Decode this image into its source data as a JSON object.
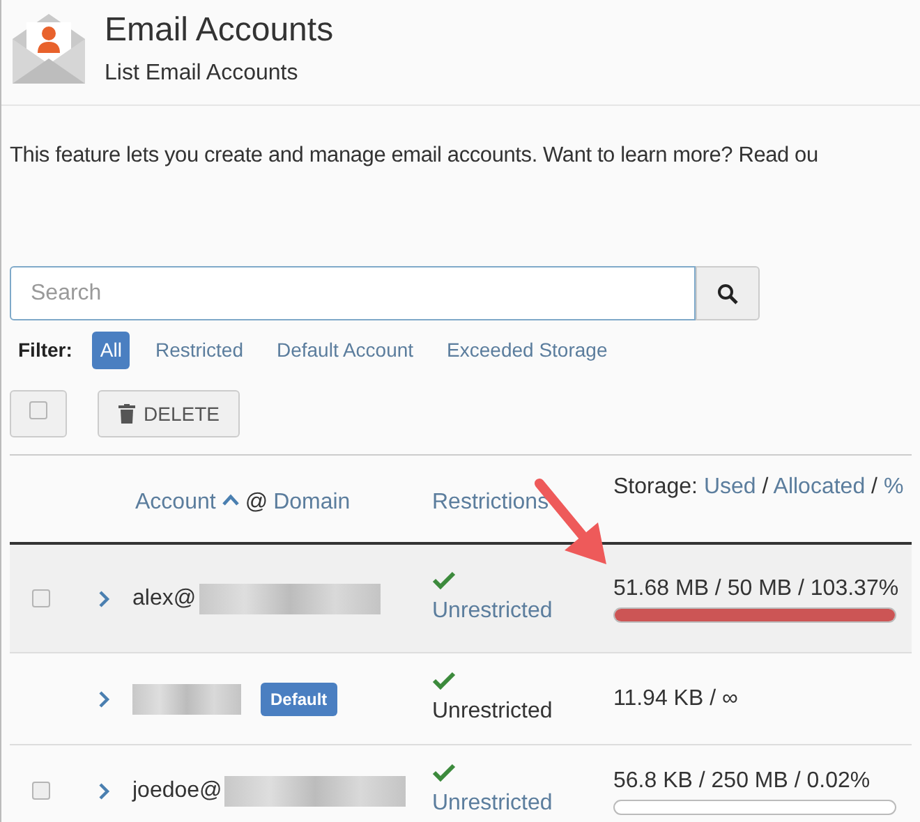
{
  "header": {
    "title": "Email Accounts",
    "subtitle": "List Email Accounts"
  },
  "description": "This feature lets you create and manage email accounts. Want to learn more? Read ou",
  "search": {
    "placeholder": "Search"
  },
  "filter": {
    "label": "Filter:",
    "options": [
      {
        "label": "All",
        "selected": true
      },
      {
        "label": "Restricted",
        "selected": false
      },
      {
        "label": "Default Account",
        "selected": false
      },
      {
        "label": "Exceeded Storage",
        "selected": false
      }
    ]
  },
  "toolbar": {
    "select_all_checked": false,
    "delete_label": "DELETE"
  },
  "table": {
    "columns": {
      "account": "Account",
      "at": "@",
      "domain": "Domain",
      "restrictions": "Restrictions",
      "storage": "Storage:",
      "used": "Used",
      "separator_1": "/",
      "allocated": "Allocated",
      "separator_2": "/",
      "percent": "%"
    },
    "rows": [
      {
        "selected": true,
        "checked": false,
        "account": "alex@",
        "restriction": "Unrestricted",
        "restriction_link": true,
        "storage": "51.68 MB / 50 MB / 103.37%",
        "level": 1,
        "exceeded": true
      },
      {
        "selected": false,
        "badge": "Default",
        "restriction": "Unrestricted",
        "restriction_link": false,
        "storage": "11.94 KB / ∞"
      },
      {
        "selected": false,
        "checked": false,
        "account": "joedoe@",
        "restriction": "Unrestricted",
        "restriction_link": true,
        "storage": "56.8 KB / 250 MB / 0.02%",
        "level": 0.0002,
        "exceeded": false
      }
    ]
  }
}
